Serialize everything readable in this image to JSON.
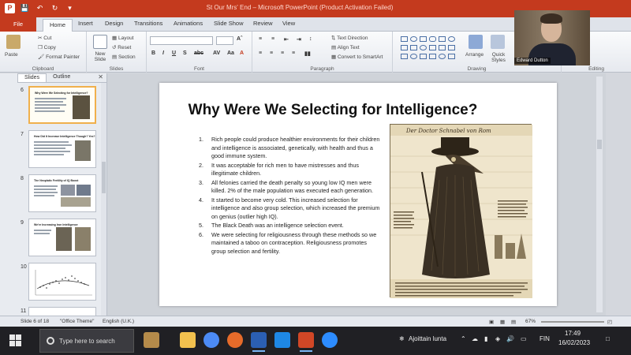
{
  "window": {
    "title": "St Our Mrs' End – Microsoft PowerPoint (Product Activation Failed)"
  },
  "ribbon": {
    "tabs": [
      "File",
      "Home",
      "Insert",
      "Design",
      "Transitions",
      "Animations",
      "Slide Show",
      "Review",
      "View"
    ],
    "active_tab": "Home",
    "clipboard": {
      "paste": "Paste",
      "cut": "Cut",
      "copy": "Copy",
      "format_painter": "Format Painter",
      "label": "Clipboard"
    },
    "slides": {
      "new_slide": "New Slide",
      "layout": "Layout",
      "reset": "Reset",
      "section": "Section",
      "label": "Slides"
    },
    "font": {
      "label": "Font"
    },
    "paragraph": {
      "text_direction": "Text Direction",
      "align_text": "Align Text",
      "convert_smartart": "Convert to SmartArt",
      "label": "Paragraph"
    },
    "drawing": {
      "arrange": "Arrange",
      "quick_styles": "Quick Styles",
      "label": "Drawing"
    },
    "editing": {
      "label": "Editing"
    }
  },
  "left_pane": {
    "tabs": [
      "Slides",
      "Outline"
    ],
    "active_tab": "Slides",
    "thumbnails": [
      {
        "number": "6",
        "title": "Why Were We Selecting for Intelligence?",
        "selected": true
      },
      {
        "number": "7",
        "title": "How Did It Increase Intelligence Though? Yes?",
        "selected": false
      },
      {
        "number": "8",
        "title": "The Neoplatic Fertility of IQ Boost",
        "selected": false
      },
      {
        "number": "9",
        "title": "We're Increasing Iron Intelligence",
        "selected": false
      },
      {
        "number": "10",
        "title": "",
        "selected": false
      },
      {
        "number": "11",
        "title": "",
        "selected": false
      }
    ]
  },
  "slide": {
    "title": "Why Were We Selecting for Intelligence?",
    "points": [
      {
        "num": "1.",
        "text": "Rich people could produce healthier environments for their children and intelligence is associated, genetically, with health and thus a good immune system."
      },
      {
        "num": "2.",
        "text": "It was acceptable for rich men to have mistresses and thus illegitimate children."
      },
      {
        "num": "3.",
        "text": "All felonies carried the death penalty so young low IQ men were killed. 2% of the male population was executed each generation."
      },
      {
        "num": "4.",
        "text": "It started to become very cold. This increased selection for intelligence and also group selection, which increased the premium on genius (outlier high IQ)."
      },
      {
        "num": "5.",
        "text": "The Black Death was an intelligence selection event."
      },
      {
        "num": "6.",
        "text": "We were selecting for religiousness through these methods so we maintained a taboo on contraception. Religiousness promotes group selection and fertility."
      }
    ],
    "image_caption": "Der Doctor Schnabel von Rom"
  },
  "status_bar": {
    "slide_info": "Slide 6 of 18",
    "theme": "\"Office Theme\"",
    "language": "English (U.K.)",
    "zoom": "67%"
  },
  "webcam": {
    "name": "Edward Dutton"
  },
  "taskbar": {
    "search_placeholder": "Type here to search",
    "weather": "Ajoittain lunta",
    "language": "FIN",
    "time": "17:49",
    "date": "16/02/2023"
  },
  "colors": {
    "ppt_accent": "#c43a1e",
    "taskbar": "#202024",
    "thumbnail_selected": "#f0b04c"
  }
}
